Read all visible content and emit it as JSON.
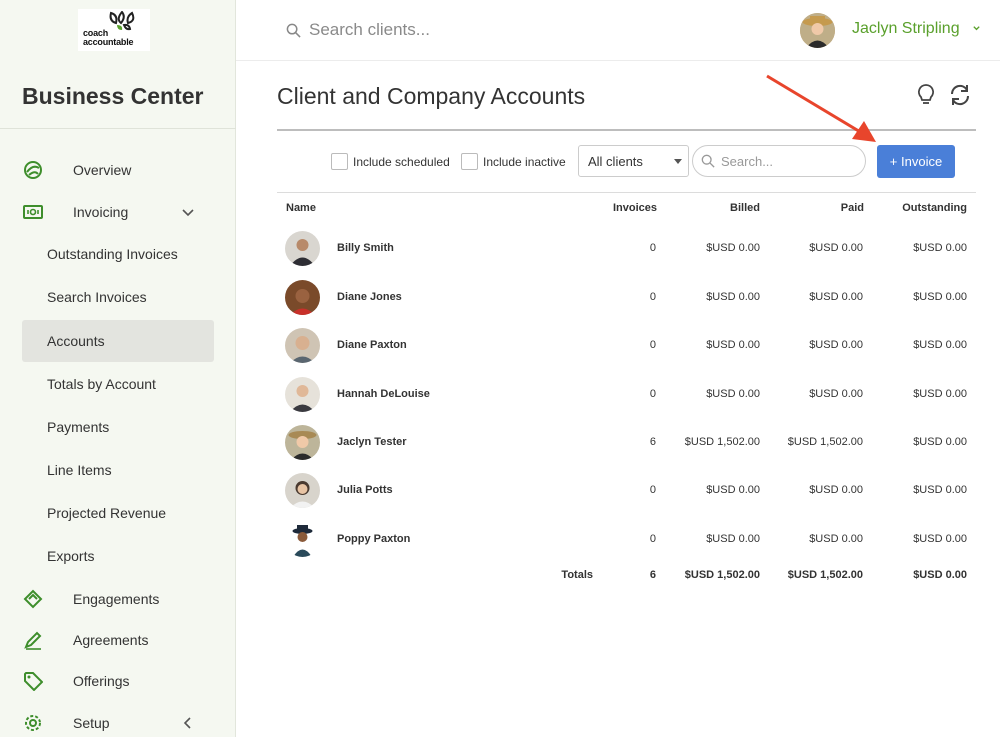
{
  "brand": {
    "logo_line1": "coach",
    "logo_line2": "accountable"
  },
  "sidebar": {
    "title": "Business Center",
    "items": [
      {
        "label": "Overview",
        "icon": "overview-icon"
      },
      {
        "label": "Invoicing",
        "icon": "invoice-icon"
      },
      {
        "label": "Outstanding Invoices"
      },
      {
        "label": "Search Invoices"
      },
      {
        "label": "Accounts",
        "active": true
      },
      {
        "label": "Totals by Account"
      },
      {
        "label": "Payments"
      },
      {
        "label": "Line Items"
      },
      {
        "label": "Projected Revenue"
      },
      {
        "label": "Exports"
      },
      {
        "label": "Engagements",
        "icon": "engagements-icon"
      },
      {
        "label": "Agreements",
        "icon": "agreements-icon"
      },
      {
        "label": "Offerings",
        "icon": "tag-icon"
      },
      {
        "label": "Setup",
        "icon": "gear-icon"
      }
    ]
  },
  "topbar": {
    "search_placeholder": "Search clients...",
    "user_name": "Jaclyn Stripling"
  },
  "main": {
    "title": "Client and Company Accounts",
    "filters": {
      "include_scheduled": "Include scheduled",
      "include_inactive": "Include inactive",
      "client_select": "All clients",
      "search_placeholder": "Search...",
      "invoice_button": "+ Invoice"
    },
    "columns": {
      "name": "Name",
      "invoices": "Invoices",
      "billed": "Billed",
      "paid": "Paid",
      "outstanding": "Outstanding"
    },
    "rows": [
      {
        "name": "Billy Smith",
        "invoices": "0",
        "billed": "$USD 0.00",
        "paid": "$USD 0.00",
        "outstanding": "$USD 0.00"
      },
      {
        "name": "Diane Jones",
        "invoices": "0",
        "billed": "$USD 0.00",
        "paid": "$USD 0.00",
        "outstanding": "$USD 0.00"
      },
      {
        "name": "Diane Paxton",
        "invoices": "0",
        "billed": "$USD 0.00",
        "paid": "$USD 0.00",
        "outstanding": "$USD 0.00"
      },
      {
        "name": "Hannah DeLouise",
        "invoices": "0",
        "billed": "$USD 0.00",
        "paid": "$USD 0.00",
        "outstanding": "$USD 0.00"
      },
      {
        "name": "Jaclyn Tester",
        "invoices": "6",
        "billed": "$USD 1,502.00",
        "paid": "$USD 1,502.00",
        "outstanding": "$USD 0.00"
      },
      {
        "name": "Julia Potts",
        "invoices": "0",
        "billed": "$USD 0.00",
        "paid": "$USD 0.00",
        "outstanding": "$USD 0.00"
      },
      {
        "name": "Poppy Paxton",
        "invoices": "0",
        "billed": "$USD 0.00",
        "paid": "$USD 0.00",
        "outstanding": "$USD 0.00"
      }
    ],
    "totals": {
      "label": "Totals",
      "invoices": "6",
      "billed": "$USD 1,502.00",
      "paid": "$USD 1,502.00",
      "outstanding": "$USD 0.00"
    }
  },
  "colors": {
    "brand_green": "#5aa02c",
    "button_blue": "#4a7fd8",
    "annotation_red": "#e8452c"
  }
}
